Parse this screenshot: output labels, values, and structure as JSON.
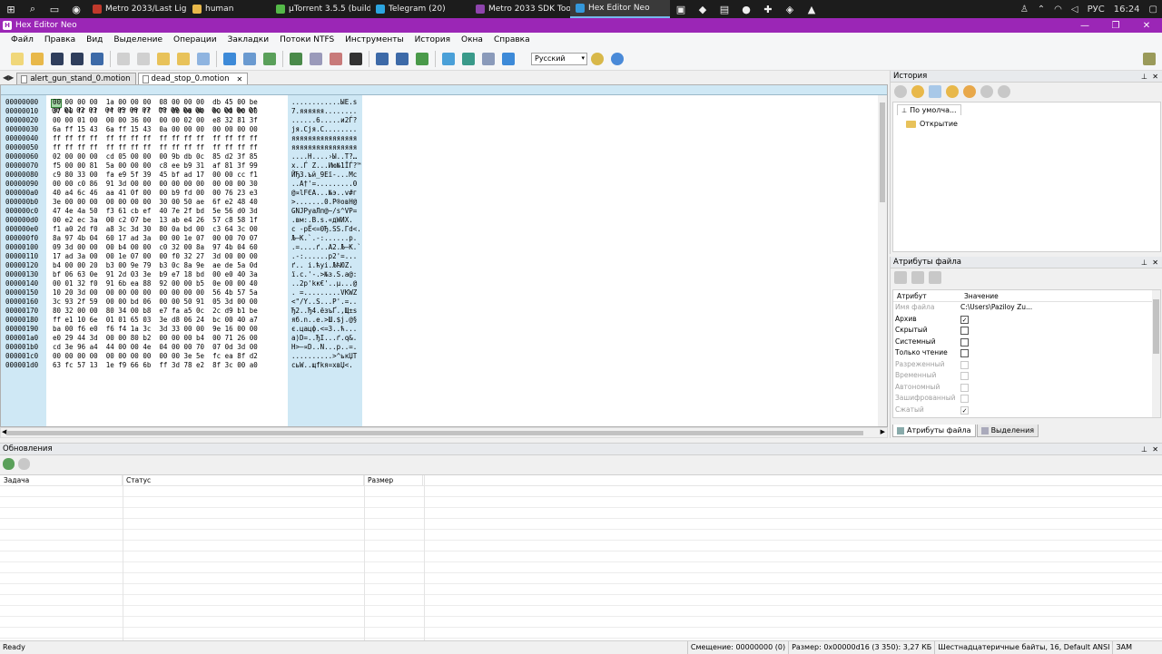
{
  "taskbar": {
    "apps": [
      {
        "name": "metro-last-light-app",
        "label": "Metro 2033/Last Light...",
        "color": "#c0392b"
      },
      {
        "name": "human-folder-app",
        "label": "human",
        "color": "#e8b84a"
      },
      {
        "name": "utorrent-app",
        "label": "µTorrent 3.5.5  (build ...",
        "color": "#54b948"
      },
      {
        "name": "telegram-app",
        "label": "Telegram (20)",
        "color": "#2ca5e0"
      },
      {
        "name": "metro-sdk-app",
        "label": "Metro 2033 SDK Tools...",
        "color": "#8e44ad"
      },
      {
        "name": "hex-editor-app",
        "label": "Hex Editor Neo",
        "color": "#3498db",
        "active": true
      }
    ],
    "lang": "РУС",
    "time": "16:24"
  },
  "window": {
    "title": "Hex Editor Neo"
  },
  "menu": [
    "Файл",
    "Правка",
    "Вид",
    "Выделение",
    "Операции",
    "Закладки",
    "Потоки NTFS",
    "Инструменты",
    "История",
    "Окна",
    "Справка"
  ],
  "toolbar": {
    "language": "Русский"
  },
  "tabs": [
    {
      "label": "alert_gun_stand_0.motion",
      "active": false
    },
    {
      "label": "dead_stop_0.motion",
      "active": true
    }
  ],
  "hex": {
    "header_offset": "00000000",
    "header_cols": "00 01 02 03  04 05 06 07  08 09 0a 0b  0c 0d 0e 0f",
    "rows": [
      {
        "o": "00000000",
        "h": "00 00 00 00  1a 00 00 00  08 00 00 00  db 45 00 be",
        "a": "............ЫE.ѕ"
      },
      {
        "o": "00000010",
        "h": "37 00 ff ff  ff ff ff ff  7f 00 00 00  00 00 00 00",
        "a": "7.яяяяяя........"
      },
      {
        "o": "00000020",
        "h": "00 00 01 00  00 00 36 00  00 00 02 00  e8 32 81 3f",
        "a": "......6.....и2Ѓ?"
      },
      {
        "o": "00000030",
        "h": "6a ff 15 43  6a ff 15 43  0a 00 00 00  00 00 00 00",
        "a": "jя.Cjя.C........"
      },
      {
        "o": "00000040",
        "h": "ff ff ff ff  ff ff ff ff  ff ff ff ff  ff ff ff ff",
        "a": "яяяяяяяяяяяяяяяя"
      },
      {
        "o": "00000050",
        "h": "ff ff ff ff  ff ff ff ff  ff ff ff ff  ff ff ff ff",
        "a": "яяяяяяяяяяяяяяяя"
      },
      {
        "o": "00000060",
        "h": "02 00 00 00  cd 05 00 00  00 9b db 0c  85 d2 3f 85",
        "a": "....Н....›Ы..Т?…"
      },
      {
        "o": "00000070",
        "h": "f5 00 00 81  5a 00 00 00  c8 ee b9 31  af 81 3f 99",
        "a": "х..Ѓ Z...Ию№1ЇЃ?™"
      },
      {
        "o": "00000080",
        "h": "c9 80 33 00  fa e9 5f 39  45 bf ad 17  00 00 cc f1",
        "a": "ЙЂ3.ъй_9Eї-...Мс"
      },
      {
        "o": "00000090",
        "h": "00 00 c0 86  91 3d 00 00  00 00 00 00  00 00 00 30",
        "a": "..А†'=.........0"
      },
      {
        "o": "000000a0",
        "h": "40 a4 6c 46  aa 41 0f 00  00 b9 fd 00  00 76 23 e3",
        "a": "@¤lFЄA...№э..v#г"
      },
      {
        "o": "000000b0",
        "h": "3e 00 00 00  00 00 00 00  30 00 50 ae  6f e2 48 40",
        "a": ">.......0.P®oвH@"
      },
      {
        "o": "000000c0",
        "h": "47 4e 4a 50  f3 61 cb ef  40 7e 2f bd  5e 56 d0 3d",
        "a": "GNJPуaЛп@~/ѕ^VР="
      },
      {
        "o": "000000d0",
        "h": "00 e2 ec 3a  00 c2 07 be  13 ab e4 26  57 c8 58 1f",
        "a": ".вм:.В.ѕ.«дWИX."
      },
      {
        "o": "000000e0",
        "h": "f1 a0 2d f0  a8 3c 3d 30  80 0a bd 00  c3 64 3c 00",
        "a": "с -рЁ<=0Ђ.ЅS.Гd<."
      },
      {
        "o": "000000f0",
        "h": "8a 97 4b 04  60 17 ad 3a  00 00 1e 07  00 00 70 07",
        "a": "Љ—K.`.-:......p."
      },
      {
        "o": "00000100",
        "h": "09 3d 00 00  00 b4 00 00  c0 32 00 8a  97 4b 04 60",
        "a": ".=....ґ..А2.Љ—K.`"
      },
      {
        "o": "00000110",
        "h": "17 ad 3a 00  00 1e 07 00  00 f0 32 27  3d 00 00 00",
        "a": ".-:......р2'=..."
      },
      {
        "o": "00000120",
        "h": "b4 00 00 20  b3 00 9e 79  b3 0c 8a 9e  ae de 5a 0d",
        "a": "ґ.. і.ћyі.ЉћЮZ."
      },
      {
        "o": "00000130",
        "h": "bf 06 63 0e  91 2d 03 3e  b9 e7 18 bd  00 e0 40 3a",
        "a": "ї.c.'-.>№з.Ѕ.а@:"
      },
      {
        "o": "00000140",
        "h": "00 01 32 f0  91 6b ea 88  92 00 00 b5  0e 00 00 40",
        "a": "..2р'kк€'..µ...@"
      },
      {
        "o": "00000150",
        "h": "10 20 3d 00  00 00 00 00  00 00 00 00  56 4b 57 5a",
        "a": ". =.........VKWZ"
      },
      {
        "o": "00000160",
        "h": "3c 93 2f 59  00 00 bd 06  00 00 50 91  05 3d 00 00",
        "a": "<\"/Y..Ѕ...P'.=.."
      },
      {
        "o": "00000170",
        "h": "80 32 00 00  80 34 00 b8  e7 fa a5 0c  2c d9 b1 be",
        "a": "Ђ2..Ђ4.ёзъҐ.,Щ±ѕ"
      },
      {
        "o": "00000180",
        "h": "ff e1 10 6e  01 01 65 03  3e d8 06 24  bc 00 40 a7",
        "a": "яб.n..e.>Ш.$ј.@§"
      },
      {
        "o": "00000190",
        "h": "ba 00 f6 e0  f6 f4 1a 3c  3d 33 00 00  9e 16 00 00",
        "a": "є.цацф.<=3..ћ..."
      },
      {
        "o": "000001a0",
        "h": "e0 29 44 3d  00 00 80 b2  00 00 00 b4  00 71 26 00",
        "a": "а)D=..ЂІ...ґ.q&."
      },
      {
        "o": "000001b0",
        "h": "cd 3e 96 a4  44 00 00 4e  04 00 00 70  07 0d 3d 00",
        "a": "Н>–¤D..N...p..=."
      },
      {
        "o": "000001c0",
        "h": "00 00 00 00  00 00 00 00  00 00 3e 5e  fc ea 8f d2",
        "a": "..........>^ькЏТ"
      },
      {
        "o": "000001d0",
        "h": "63 fc 57 13  1e f9 66 6b  ff 3d 78 e2  8f 3c 00 a0",
        "a": "сьW..щfkя=xвЏ<. "
      }
    ]
  },
  "history": {
    "title": "История",
    "tab": "По умолча...",
    "item": "Открытие"
  },
  "attributes": {
    "title": "Атрибуты файла",
    "col_attr": "Атрибут",
    "col_value": "Значение",
    "rows": [
      {
        "name": "Имя файла",
        "value": "C:\\Users\\Paziloy Zu...",
        "type": "text",
        "disabled": true
      },
      {
        "name": "Архив",
        "checked": "✓",
        "type": "cb",
        "disabled": false
      },
      {
        "name": "Скрытый",
        "checked": "",
        "type": "cb",
        "disabled": false
      },
      {
        "name": "Системный",
        "checked": "",
        "type": "cb",
        "disabled": false
      },
      {
        "name": "Только чтение",
        "checked": "",
        "type": "cb",
        "disabled": false
      },
      {
        "name": "Разреженный",
        "checked": "",
        "type": "cb",
        "disabled": true
      },
      {
        "name": "Временный",
        "checked": "",
        "type": "cb",
        "disabled": true
      },
      {
        "name": "Автономный",
        "checked": "",
        "type": "cb",
        "disabled": true
      },
      {
        "name": "Зашифрованный",
        "checked": "",
        "type": "cb",
        "disabled": true
      },
      {
        "name": "Сжатый",
        "checked": "✓",
        "type": "cb",
        "disabled": true
      }
    ],
    "tab_attrs": "Атрибуты файла",
    "tab_sel": "Выделения"
  },
  "updates": {
    "title": "Обновления",
    "col_task": "Задача",
    "col_status": "Статус",
    "col_size": "Размер"
  },
  "status": {
    "left": "Ready",
    "offset": "Смещение: 00000000 (0)",
    "size": "Размер: 0x00000d16 (3 350): 3,27 КБ",
    "mode": "Шестнадцатеричные байты, 16, Default ANSI",
    "ovr": "ЗАМ"
  },
  "colors": {
    "accent": "#9b26b6",
    "hexbg": "#cfe8f5"
  }
}
